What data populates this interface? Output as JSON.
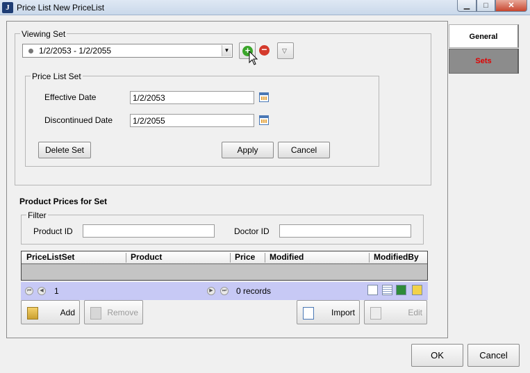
{
  "window": {
    "title": "Price List New PriceList",
    "min": "▁",
    "max": "□",
    "close": "✕",
    "app_icon": "J"
  },
  "viewing_set": {
    "label": "Viewing Set",
    "selected": "1/2/2053 - 1/2/2055",
    "add_icon": "plus-circle-icon",
    "remove_icon": "minus-circle-icon",
    "menu_icon": "triangle-down-icon"
  },
  "price_list_set": {
    "label": "Price List Set",
    "effective_label": "Effective Date",
    "effective_value": "1/2/2053",
    "discontinued_label": "Discontinued Date",
    "discontinued_value": "1/2/2055",
    "delete_label": "Delete Set",
    "apply_label": "Apply",
    "cancel_label": "Cancel"
  },
  "product_prices": {
    "heading": "Product Prices for Set",
    "filter_label": "Filter",
    "product_id_label": "Product ID",
    "product_id_value": "",
    "doctor_id_label": "Doctor ID",
    "doctor_id_value": ""
  },
  "grid": {
    "columns": [
      "PriceListSet",
      "Product",
      "Price",
      "Modified",
      "ModifiedBy"
    ],
    "rows": []
  },
  "pager": {
    "page": "1",
    "records": "0 records"
  },
  "actions": {
    "add": "Add",
    "remove": "Remove",
    "import": "Import",
    "edit": "Edit"
  },
  "tabs": {
    "general": "General",
    "sets": "Sets"
  },
  "dialog": {
    "ok": "OK",
    "cancel": "Cancel"
  },
  "colors": {
    "tab_sets_text": "#e00000",
    "pager_bg": "#c7c9f5",
    "add_green": "#3aa52a",
    "remove_red": "#d43a2c"
  }
}
